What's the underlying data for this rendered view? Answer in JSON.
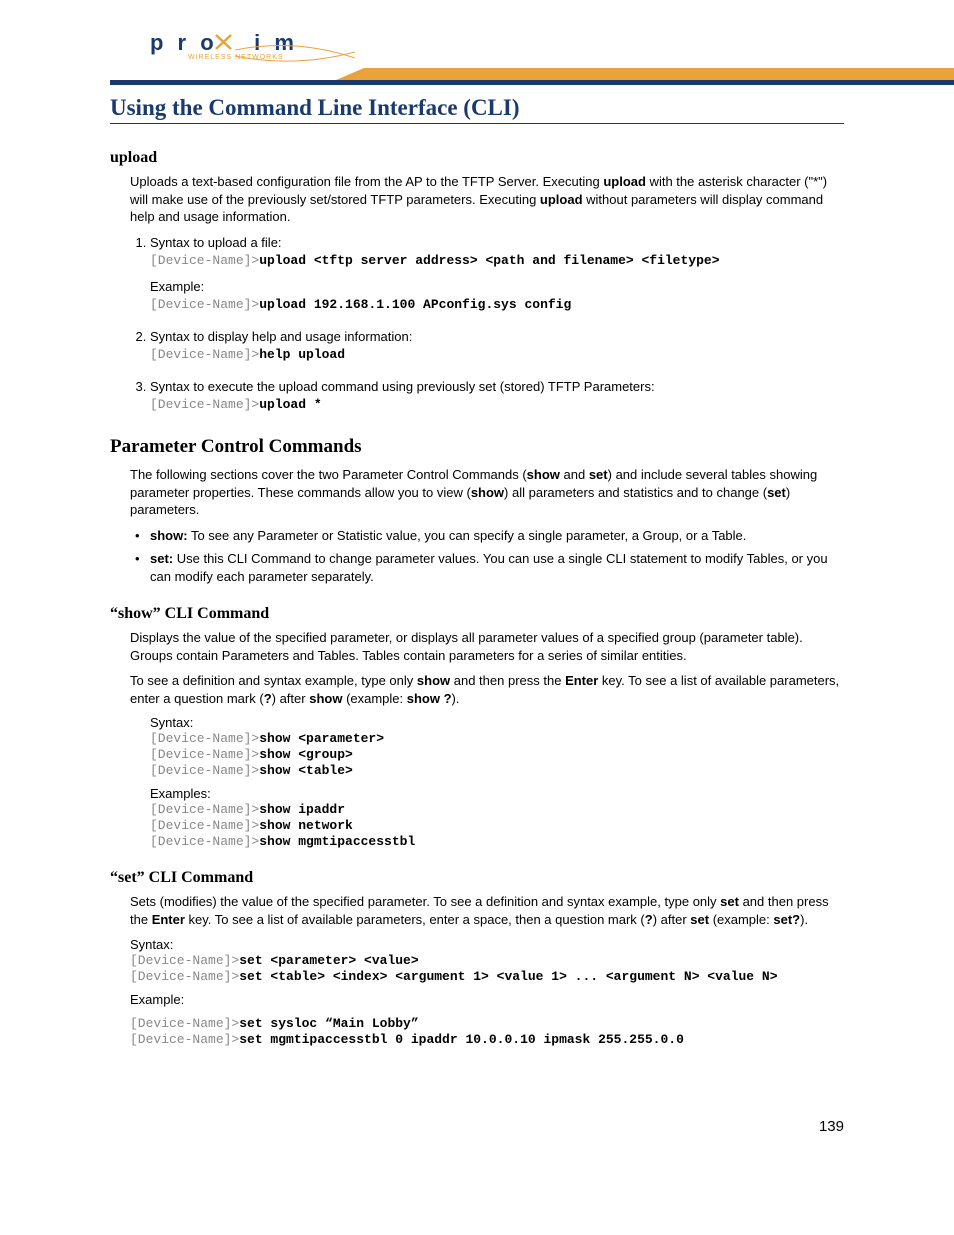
{
  "logo": {
    "brand": "p r o x i m",
    "sub": "WIRELESS NETWORKS"
  },
  "title": "Using the Command Line Interface (CLI)",
  "upload": {
    "heading": "upload",
    "intro_a": "Uploads a text-based configuration file from the AP to the TFTP Server. Executing ",
    "intro_b": "upload",
    "intro_c": " with the asterisk character (\"*\") will make use of the previously set/stored TFTP parameters. Executing ",
    "intro_d": "upload",
    "intro_e": " without parameters will display command help and usage information.",
    "li1": "Syntax to upload a file:",
    "li1_prompt": "[Device-Name]>",
    "li1_cmd": "upload <tftp server address> <path and filename> <filetype>",
    "li1_ex_label": "Example:",
    "li1_ex_prompt": "[Device-Name]>",
    "li1_ex_cmd": "upload 192.168.1.100 APconfig.sys config",
    "li2": "Syntax to display help and usage information:",
    "li2_prompt": "[Device-Name]>",
    "li2_cmd": "help upload",
    "li3": "Syntax to execute the upload command using previously set (stored) TFTP Parameters:",
    "li3_prompt": "[Device-Name]>",
    "li3_cmd": "upload *"
  },
  "pcc": {
    "heading": "Parameter Control Commands",
    "p_a": "The following sections cover the two Parameter Control Commands (",
    "p_b": "show",
    "p_c": " and ",
    "p_d": "set",
    "p_e": ") and include several tables showing parameter properties. These commands allow you to view (",
    "p_f": "show",
    "p_g": ") all parameters and statistics and to change (",
    "p_h": "set",
    "p_i": ") parameters.",
    "b1_a": "show:",
    "b1_b": " To see any Parameter or Statistic value, you can specify a single parameter, a Group, or a Table.",
    "b2_a": "set:",
    "b2_b": " Use this CLI Command to change parameter values. You can use a single CLI statement to modify Tables, or you can modify each parameter separately."
  },
  "show": {
    "heading": "“show” CLI Command",
    "p1": "Displays the value of the specified parameter, or displays all parameter values of a specified group (parameter table). Groups contain Parameters and Tables. Tables contain parameters for a series of similar entities.",
    "p2_a": "To see a definition and syntax example, type only ",
    "p2_b": "show",
    "p2_c": " and then press the ",
    "p2_d": "Enter",
    "p2_e": " key. To see a list of available parameters, enter a question mark (",
    "p2_f": "?",
    "p2_g": ") after ",
    "p2_h": "show",
    "p2_i": " (example: ",
    "p2_j": "show ?",
    "p2_k": ").",
    "syn_label": "Syntax:",
    "s1p": "[Device-Name]>",
    "s1c": "show <parameter>",
    "s2p": "[Device-Name]>",
    "s2c": "show <group>",
    "s3p": "[Device-Name]>",
    "s3c": "show <table>",
    "ex_label": "Examples:",
    "e1p": "[Device-Name]>",
    "e1c": "show ipaddr",
    "e2p": "[Device-Name]>",
    "e2c": "show network",
    "e3p": "[Device-Name]>",
    "e3c": "show mgmtipaccesstbl"
  },
  "set": {
    "heading": "“set” CLI Command",
    "p_a": "Sets (modifies) the value of the specified parameter. To see a definition and syntax example, type only ",
    "p_b": "set",
    "p_c": " and then press the ",
    "p_d": "Enter",
    "p_e": " key. To see a list of available parameters, enter a space, then a question mark (",
    "p_f": "?",
    "p_g": ") after ",
    "p_h": "set",
    "p_i": " (example: ",
    "p_j": "set?",
    "p_k": ").",
    "syn_label": "Syntax:",
    "s1p": "[Device-Name]>",
    "s1c": "set <parameter> <value>",
    "s2p": "[Device-Name]>",
    "s2c": "set <table> <index> <argument 1> <value 1> ... <argument N> <value N>",
    "ex_label": "Example:",
    "e1p": "[Device-Name]>",
    "e1c": "set sysloc “Main Lobby”",
    "e2p": "[Device-Name]>",
    "e2c": "set mgmtipaccesstbl 0 ipaddr 10.0.0.10 ipmask 255.255.0.0"
  },
  "pagenum": "139"
}
